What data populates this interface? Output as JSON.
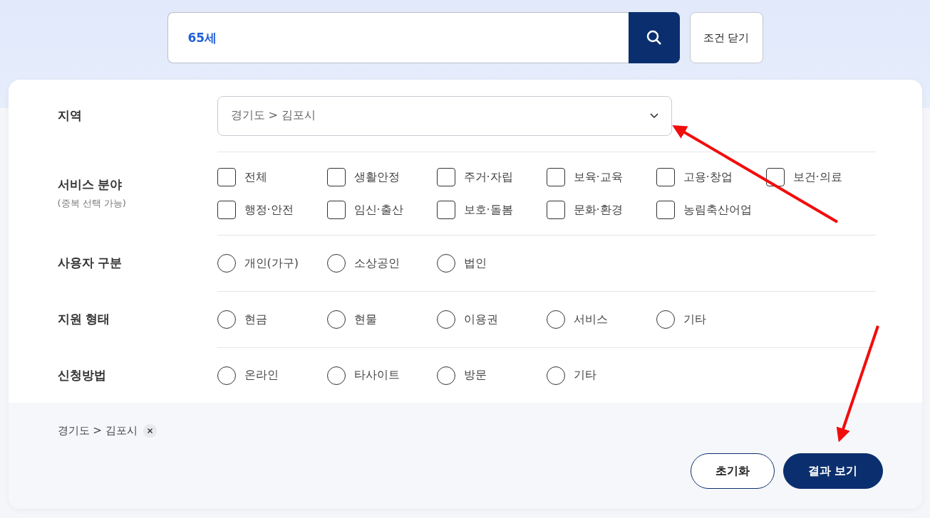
{
  "search": {
    "value": "65세"
  },
  "close_button": "조건 닫기",
  "filters": [
    {
      "label": "지역",
      "kind": "select",
      "value": "경기도 > 김포시"
    },
    {
      "label": "서비스 분야",
      "note": "(중복 선택 가능)",
      "kind": "checkbox",
      "options": [
        {
          "label": "전체",
          "checked": false
        },
        {
          "label": "생활안정",
          "checked": false
        },
        {
          "label": "주거·자립",
          "checked": false
        },
        {
          "label": "보육·교육",
          "checked": false
        },
        {
          "label": "고용·창업",
          "checked": false
        },
        {
          "label": "보건·의료",
          "checked": false
        },
        {
          "label": "행정·안전",
          "checked": false
        },
        {
          "label": "임신·출산",
          "checked": false
        },
        {
          "label": "보호·돌봄",
          "checked": false
        },
        {
          "label": "문화·환경",
          "checked": false
        },
        {
          "label": "농림축산어업",
          "checked": false
        }
      ]
    },
    {
      "label": "사용자 구분",
      "kind": "radio",
      "options": [
        {
          "label": "개인(가구)",
          "selected": false
        },
        {
          "label": "소상공인",
          "selected": false
        },
        {
          "label": "법인",
          "selected": false
        }
      ]
    },
    {
      "label": "지원 형태",
      "kind": "radio",
      "options": [
        {
          "label": "현금",
          "selected": false
        },
        {
          "label": "현물",
          "selected": false
        },
        {
          "label": "이용권",
          "selected": false
        },
        {
          "label": "서비스",
          "selected": false
        },
        {
          "label": "기타",
          "selected": false
        }
      ]
    },
    {
      "label": "신청방법",
      "kind": "radio",
      "options": [
        {
          "label": "온라인",
          "selected": false
        },
        {
          "label": "타사이트",
          "selected": false
        },
        {
          "label": "방문",
          "selected": false
        },
        {
          "label": "기타",
          "selected": false
        }
      ]
    }
  ],
  "selected_tags": [
    {
      "label": "경기도 > 김포시"
    }
  ],
  "buttons": [
    {
      "label": "초기화",
      "kind": "outline"
    },
    {
      "label": "결과 보기",
      "kind": "primary"
    }
  ]
}
